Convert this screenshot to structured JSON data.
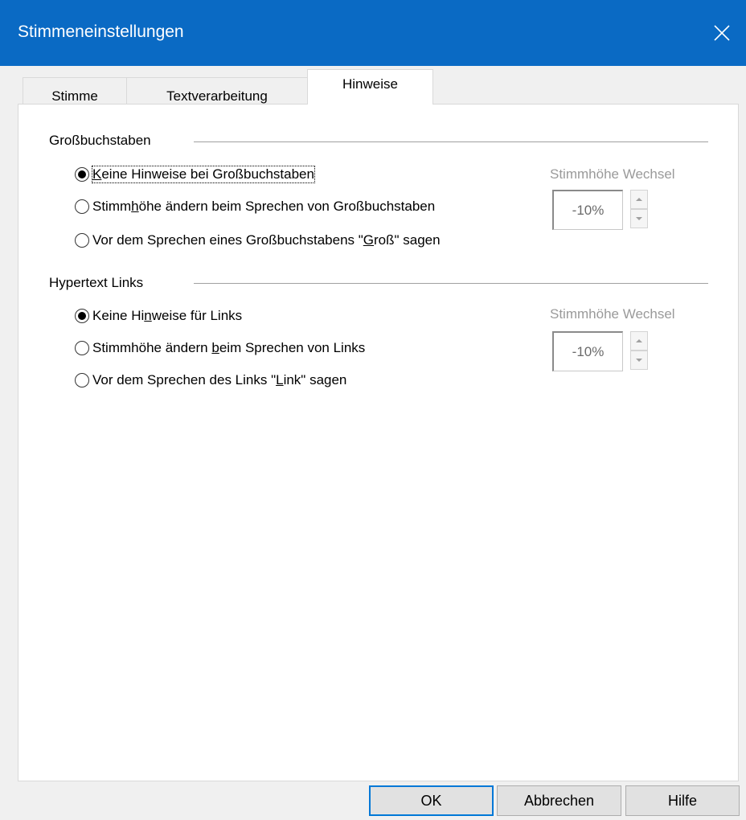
{
  "window": {
    "title": "Stimmeneinstellungen",
    "close_icon": "close-icon"
  },
  "tabs": [
    {
      "label": "Stimme",
      "active": false
    },
    {
      "label": "Textverarbeitung",
      "active": false
    },
    {
      "label": "Hinweise",
      "active": true
    }
  ],
  "groups": {
    "capitals": {
      "title": "Großbuchstaben",
      "options": [
        {
          "pre": "",
          "ul": "K",
          "post": "eine Hinweise bei Großbuchstaben",
          "checked": true
        },
        {
          "pre": "Stimm",
          "ul": "h",
          "post": "öhe ändern beim Sprechen von Großbuchstaben",
          "checked": false
        },
        {
          "pre": "Vor dem Sprechen eines Großbuchstabens \"",
          "ul": "G",
          "post": "roß\" sagen",
          "checked": false
        }
      ],
      "pitch_label": "Stimmhöhe Wechsel",
      "pitch_value": "-10%"
    },
    "links": {
      "title": "Hypertext Links",
      "options": [
        {
          "pre": "Keine Hi",
          "ul": "n",
          "post": "weise für Links",
          "checked": true
        },
        {
          "pre": "Stimmhöhe ändern ",
          "ul": "b",
          "post": "eim Sprechen von Links",
          "checked": false
        },
        {
          "pre": "Vor dem Sprechen des Links \"",
          "ul": "L",
          "post": "ink\" sagen",
          "checked": false
        }
      ],
      "pitch_label": "Stimmhöhe Wechsel",
      "pitch_value": "-10%"
    }
  },
  "buttons": {
    "ok": "OK",
    "cancel": "Abbrechen",
    "help": "Hilfe"
  },
  "colors": {
    "titlebar": "#0a6ac4",
    "default_button_border": "#0078d7"
  }
}
